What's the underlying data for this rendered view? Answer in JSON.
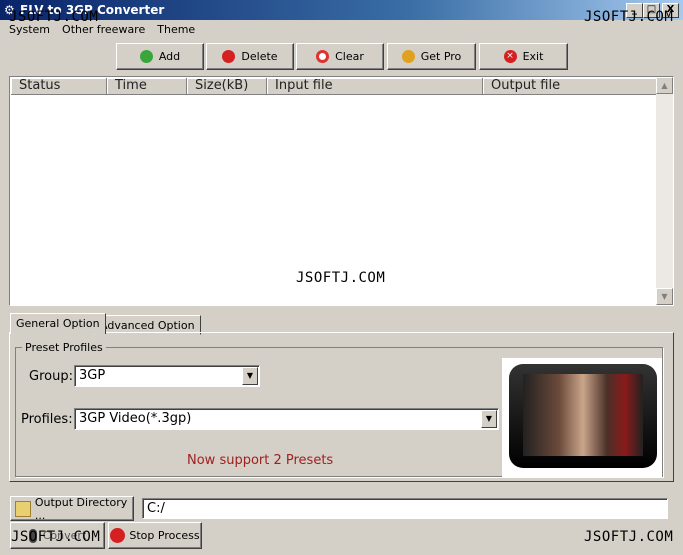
{
  "window": {
    "title": "FLV to 3GP Converter",
    "minimize": "_",
    "maximize": "□",
    "close": "X"
  },
  "watermark": "JSOFTJ.COM",
  "menu": [
    "System",
    "Other freeware",
    "Theme"
  ],
  "toolbar": [
    {
      "label": "Add",
      "icon": "add-icon",
      "color": "#3aa53a"
    },
    {
      "label": "Delete",
      "icon": "delete-icon",
      "color": "#d42020"
    },
    {
      "label": "Clear",
      "icon": "clear-icon",
      "color": "#e03030"
    },
    {
      "label": "Get Pro",
      "icon": "smiley-icon",
      "color": "#e0a020"
    },
    {
      "label": "Exit",
      "icon": "exit-icon",
      "color": "#d42020"
    }
  ],
  "list": {
    "columns": [
      "Status",
      "Time",
      "Size(kB)",
      "Input file",
      "Output file"
    ],
    "rows": []
  },
  "tabs": [
    "General Option",
    "Advanced Option"
  ],
  "general": {
    "group_title": "Preset Profiles",
    "group_label": "Group:",
    "group_value": "3GP",
    "profiles_label": "Profiles:",
    "profiles_value": "3GP Video(*.3gp)",
    "notice": "Now support 2 Presets",
    "notice_color": "#a02020"
  },
  "output": {
    "button": "Output Directory ...",
    "path": "C:/"
  },
  "actions": {
    "convert": "Convert",
    "stop": "Stop Process"
  }
}
